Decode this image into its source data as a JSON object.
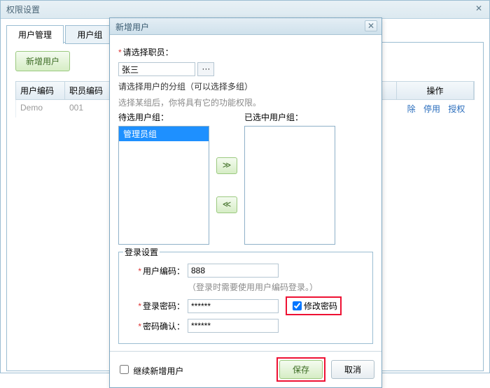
{
  "outerWindow": {
    "title": "权限设置",
    "close": "✕"
  },
  "tabs": {
    "active": "用户管理",
    "inactive": "用户组"
  },
  "toolbar": {
    "addUser": "新增用户"
  },
  "grid": {
    "headers": {
      "userCode": "用户编码",
      "empCode": "职员编码",
      "ops": "操作"
    },
    "row": {
      "userCode": "Demo",
      "empCode": "001"
    },
    "ops": {
      "del": "除",
      "disable": "停用",
      "auth": "授权"
    }
  },
  "modal": {
    "title": "新增用户",
    "close": "✕",
    "selectEmpLabel": "请选择职员：",
    "empValue": "张三",
    "empPick": "···",
    "groupPrompt": "请选择用户的分组（可以选择多组）",
    "groupHint": "选择某组后，你将具有它的功能权限。",
    "availLabel": "待选用户组：",
    "selectedLabel": "已选中用户组：",
    "availItem": "管理员组",
    "moveRight": "≫",
    "moveLeft": "≪",
    "login": {
      "legend": "登录设置",
      "userCodeLabel": "用户编码：",
      "userCodeValue": "888",
      "userCodeHint": "（登录时需要使用用户编码登录。）",
      "pwdLabel": "登录密码：",
      "pwdValue": "******",
      "changePwd": "修改密码",
      "confirmLabel": "密码确认：",
      "confirmValue": "******"
    },
    "footer": {
      "continueAdd": "继续新增用户",
      "save": "保存",
      "cancel": "取消"
    }
  }
}
